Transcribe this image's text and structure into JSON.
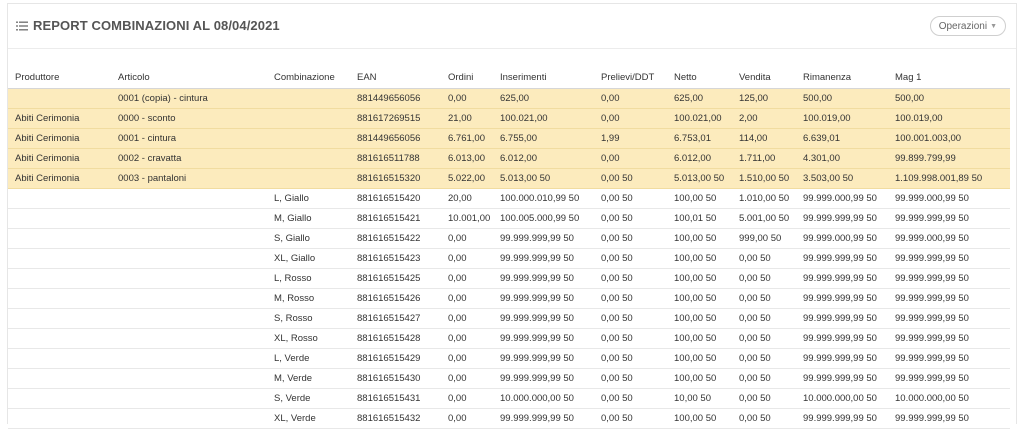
{
  "header": {
    "title": "REPORT COMBINAZIONI AL 08/04/2021",
    "operations_label": "Operazioni"
  },
  "table": {
    "columns": [
      "Produttore",
      "Articolo",
      "Combinazione",
      "EAN",
      "Ordini",
      "Inserimenti",
      "Prelievi/DDT",
      "Netto",
      "Vendita",
      "Rimanenza",
      "Mag 1"
    ],
    "rows": [
      {
        "highlight": true,
        "cells": [
          "",
          "0001 (copia) - cintura",
          "",
          "881449656056",
          "0,00",
          "625,00",
          "0,00",
          "625,00",
          "125,00",
          "500,00",
          "500,00"
        ]
      },
      {
        "highlight": true,
        "cells": [
          "Abiti Cerimonia",
          "0000 - sconto",
          "",
          "881617269515",
          "21,00",
          "100.021,00",
          "0,00",
          "100.021,00",
          "2,00",
          "100.019,00",
          "100.019,00"
        ]
      },
      {
        "highlight": true,
        "cells": [
          "Abiti Cerimonia",
          "0001 - cintura",
          "",
          "881449656056",
          "6.761,00",
          "6.755,00",
          "1,99",
          "6.753,01",
          "114,00",
          "6.639,01",
          "100.001.003,00"
        ]
      },
      {
        "highlight": true,
        "cells": [
          "Abiti Cerimonia",
          "0002 - cravatta",
          "",
          "881616511788",
          "6.013,00",
          "6.012,00",
          "0,00",
          "6.012,00",
          "1.711,00",
          "4.301,00",
          "99.899.799,99"
        ]
      },
      {
        "highlight": true,
        "cells": [
          "Abiti Cerimonia",
          "0003 - pantaloni",
          "",
          "881616515320",
          "5.022,00",
          "5.013,00 50",
          "0,00 50",
          "5.013,00 50",
          "1.510,00 50",
          "3.503,00 50",
          "1.109.998.001,89 50"
        ]
      },
      {
        "highlight": false,
        "cells": [
          "",
          "",
          "L, Giallo",
          "881616515420",
          "20,00",
          "100.000.010,99 50",
          "0,00 50",
          "100,00 50",
          "1.010,00 50",
          "99.999.000,99 50",
          "99.999.000,99 50"
        ]
      },
      {
        "highlight": false,
        "cells": [
          "",
          "",
          "M, Giallo",
          "881616515421",
          "10.001,00",
          "100.005.000,99 50",
          "0,00 50",
          "100,01 50",
          "5.001,00 50",
          "99.999.999,99 50",
          "99.999.999,99 50"
        ]
      },
      {
        "highlight": false,
        "cells": [
          "",
          "",
          "S, Giallo",
          "881616515422",
          "0,00",
          "99.999.999,99 50",
          "0,00 50",
          "100,00 50",
          "999,00 50",
          "99.999.000,99 50",
          "99.999.000,99 50"
        ]
      },
      {
        "highlight": false,
        "cells": [
          "",
          "",
          "XL, Giallo",
          "881616515423",
          "0,00",
          "99.999.999,99 50",
          "0,00 50",
          "100,00 50",
          "0,00 50",
          "99.999.999,99 50",
          "99.999.999,99 50"
        ]
      },
      {
        "highlight": false,
        "cells": [
          "",
          "",
          "L, Rosso",
          "881616515425",
          "0,00",
          "99.999.999,99 50",
          "0,00 50",
          "100,00 50",
          "0,00 50",
          "99.999.999,99 50",
          "99.999.999,99 50"
        ]
      },
      {
        "highlight": false,
        "cells": [
          "",
          "",
          "M, Rosso",
          "881616515426",
          "0,00",
          "99.999.999,99 50",
          "0,00 50",
          "100,00 50",
          "0,00 50",
          "99.999.999,99 50",
          "99.999.999,99 50"
        ]
      },
      {
        "highlight": false,
        "cells": [
          "",
          "",
          "S, Rosso",
          "881616515427",
          "0,00",
          "99.999.999,99 50",
          "0,00 50",
          "100,00 50",
          "0,00 50",
          "99.999.999,99 50",
          "99.999.999,99 50"
        ]
      },
      {
        "highlight": false,
        "cells": [
          "",
          "",
          "XL, Rosso",
          "881616515428",
          "0,00",
          "99.999.999,99 50",
          "0,00 50",
          "100,00 50",
          "0,00 50",
          "99.999.999,99 50",
          "99.999.999,99 50"
        ]
      },
      {
        "highlight": false,
        "cells": [
          "",
          "",
          "L, Verde",
          "881616515429",
          "0,00",
          "99.999.999,99 50",
          "0,00 50",
          "100,00 50",
          "0,00 50",
          "99.999.999,99 50",
          "99.999.999,99 50"
        ]
      },
      {
        "highlight": false,
        "cells": [
          "",
          "",
          "M, Verde",
          "881616515430",
          "0,00",
          "99.999.999,99 50",
          "0,00 50",
          "100,00 50",
          "0,00 50",
          "99.999.999,99 50",
          "99.999.999,99 50"
        ]
      },
      {
        "highlight": false,
        "cells": [
          "",
          "",
          "S, Verde",
          "881616515431",
          "0,00",
          "10.000.000,00 50",
          "0,00 50",
          "10,00 50",
          "0,00 50",
          "10.000.000,00 50",
          "10.000.000,00 50"
        ]
      },
      {
        "highlight": false,
        "cells": [
          "",
          "",
          "XL, Verde",
          "881616515432",
          "0,00",
          "99.999.999,99 50",
          "0,00 50",
          "100,00 50",
          "0,00 50",
          "99.999.999,99 50",
          "99.999.999,99 50"
        ]
      }
    ]
  },
  "colors": {
    "highlight_row": "#fcebbd",
    "title_text": "#555555"
  },
  "icons": {
    "title_icon": "list-icon",
    "operations_icon": "chevron-down-icon"
  }
}
